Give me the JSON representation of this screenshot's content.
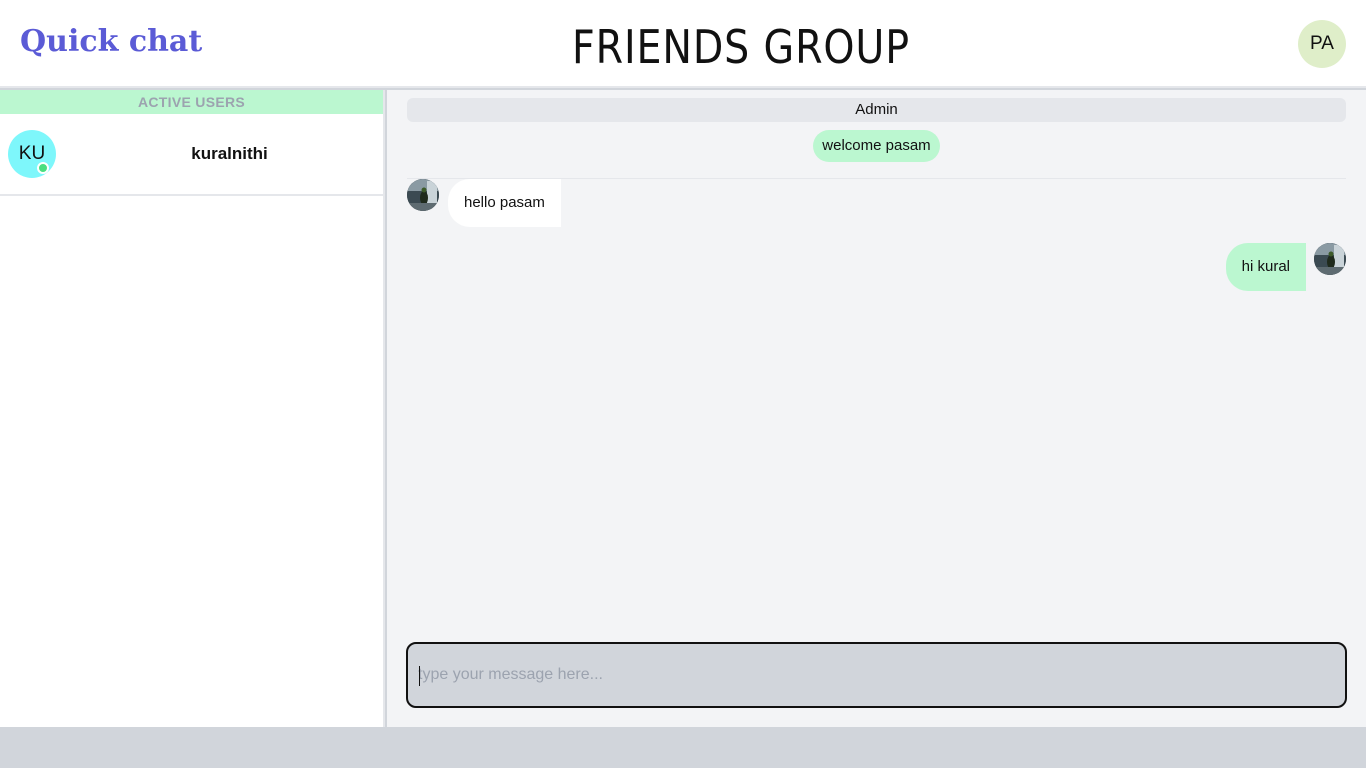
{
  "header": {
    "brand": "Quick chat",
    "room_title": "FRIENDS GROUP",
    "me_initials": "PA"
  },
  "sidebar": {
    "section_title": "ACTIVE USERS",
    "users": [
      {
        "initials": "KU",
        "name": "kuralnithi",
        "status": "online"
      }
    ]
  },
  "chat": {
    "admin_label": "Admin",
    "system_message": "welcome pasam",
    "messages": [
      {
        "direction": "incoming",
        "text": "hello pasam",
        "avatar": "user-photo-icon"
      },
      {
        "direction": "outgoing",
        "text": "hi kural",
        "avatar": "user-photo-icon"
      }
    ],
    "composer": {
      "placeholder": "type your message here...",
      "value": ""
    }
  },
  "colors": {
    "brand": "#5b5bd6",
    "accent_green": "#bbf7d0",
    "online": "#4ade80",
    "avatar_cyan": "#7ef7fb",
    "me_avatar": "#dfeec9"
  }
}
